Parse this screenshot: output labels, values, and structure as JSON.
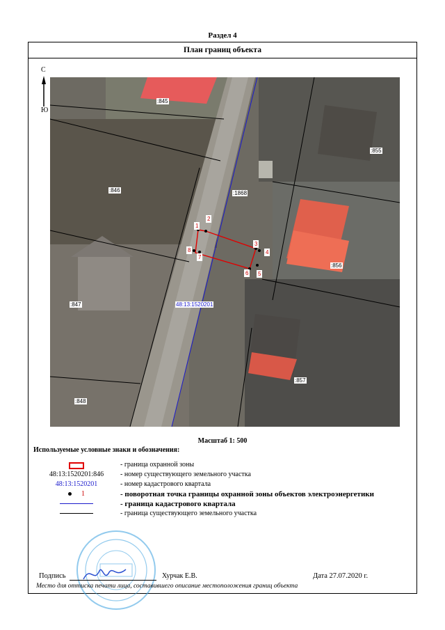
{
  "section_title": "Раздел 4",
  "plan_header": "План границ объекта",
  "compass": {
    "north": "С",
    "south": "Ю"
  },
  "map": {
    "parcels": [
      ":845",
      ":855",
      ":846",
      ":1868",
      ":856",
      ":847",
      ":857",
      ":848"
    ],
    "quarter_label": "48:13:1520201",
    "points": [
      "1",
      "2",
      "3",
      "4",
      "5",
      "6",
      "7",
      "8"
    ]
  },
  "scale": "Масштаб 1: 500",
  "legend": {
    "title": "Используемые условные знаки и обозначения:",
    "items": [
      {
        "symbol": "",
        "text": "- граница  охранной зоны"
      },
      {
        "symbol": "48:13:1520201:846",
        "text": "- номер существующего земельного участка"
      },
      {
        "symbol": "48:13:1520201",
        "text": "- номер кадастрового квартала"
      },
      {
        "symbol": "1",
        "text": "- поворотная точка границы охранной зоны объектов электроэнергетики"
      },
      {
        "symbol": "",
        "text": "- граница кадастрового квартала"
      },
      {
        "symbol": "",
        "text": "- граница существующего земельного участка"
      }
    ]
  },
  "footer": {
    "sign_label": "Подпись",
    "signer": "Хурчак Е.В.",
    "date": "Дата 27.07.2020 г.",
    "stamp_note": "Место для оттиска печати лица, составившего описание местоположения границ объекта"
  },
  "colors": {
    "zone_border": "#e00000",
    "quarter_line": "#1a1acc",
    "stamp": "#3aa0e0"
  }
}
